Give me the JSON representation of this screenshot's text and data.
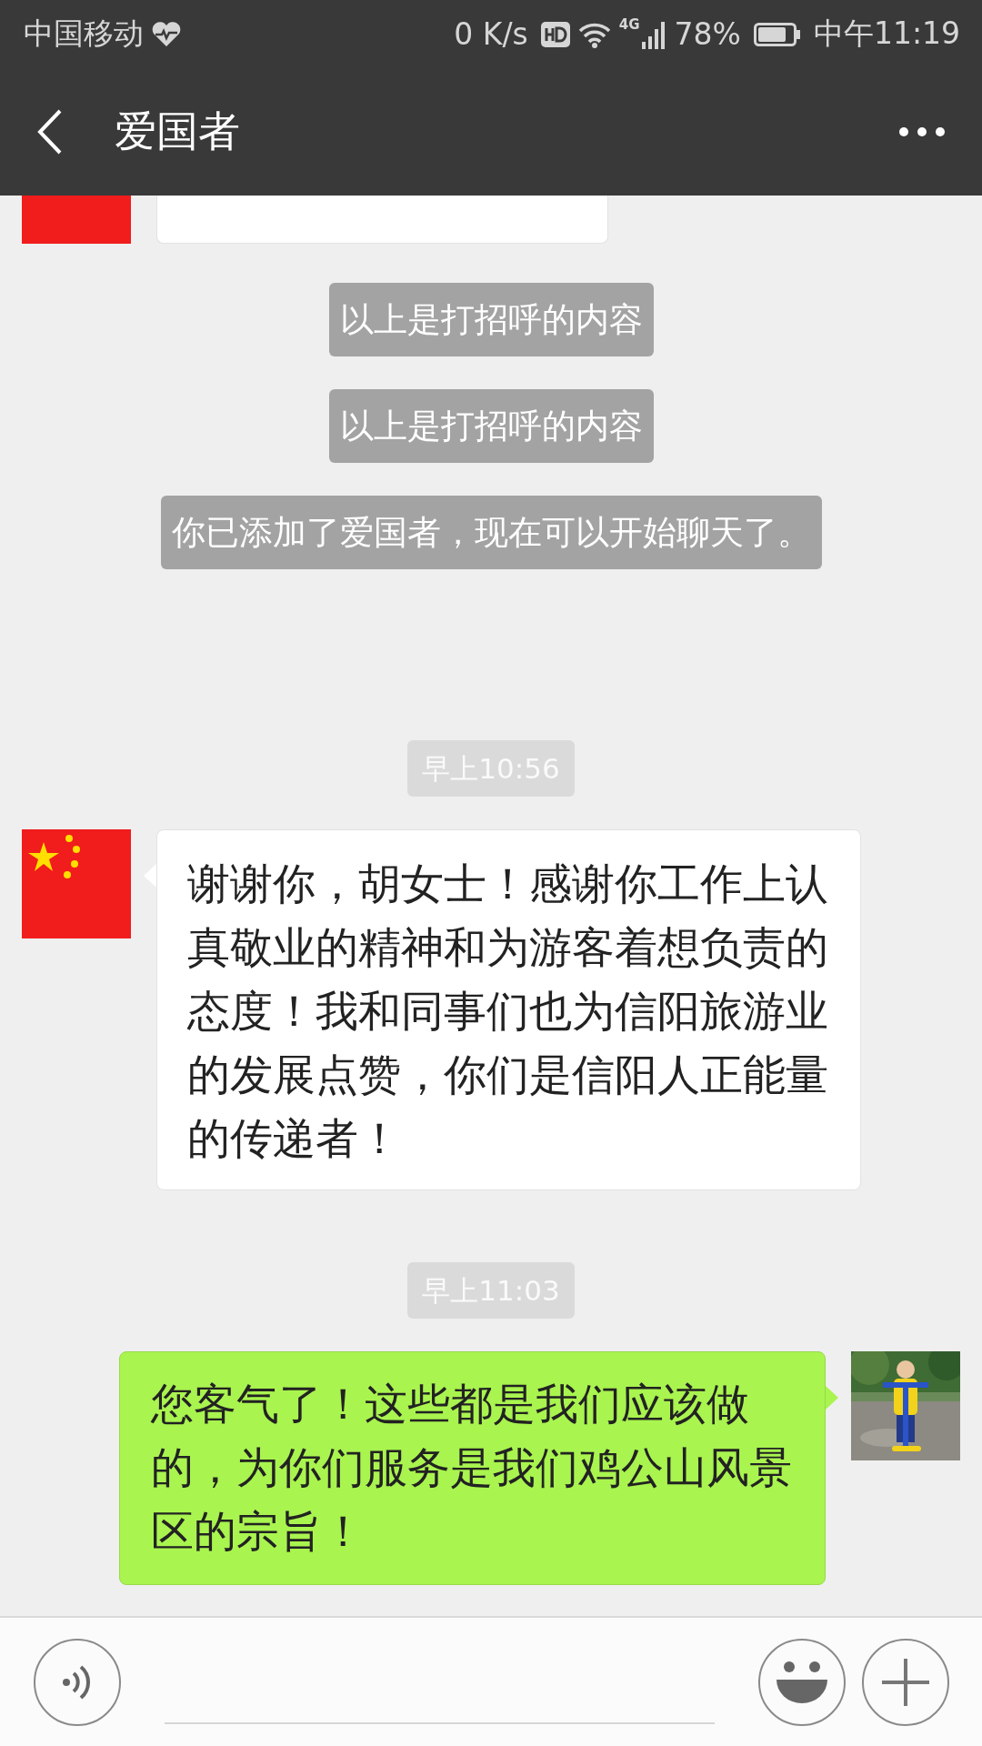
{
  "status_bar": {
    "carrier": "中国移动",
    "speed": "0 K/s",
    "network": "4G",
    "battery": "78%",
    "time": "中午11:19"
  },
  "header": {
    "title": "爱国者"
  },
  "messages": [
    {
      "kind": "incoming_cut"
    },
    {
      "kind": "note",
      "text": "以上是打招呼的内容"
    },
    {
      "kind": "note",
      "text": "以上是打招呼的内容"
    },
    {
      "kind": "note",
      "text": "你已添加了爱国者，现在可以开始聊天了。"
    },
    {
      "kind": "time",
      "text": "早上10:56"
    },
    {
      "kind": "incoming",
      "text": "谢谢你，胡女士！感谢你工作上认真敬业的精神和为游客着想负责的态度！我和同事们也为信阳旅游业的发展点赞，你们是信阳人正能量的传递者！"
    },
    {
      "kind": "time",
      "text": "早上11:03"
    },
    {
      "kind": "outgoing",
      "text": "您客气了！这些都是我们应该做的，为你们服务是我们鸡公山风景区的宗旨！"
    }
  ]
}
